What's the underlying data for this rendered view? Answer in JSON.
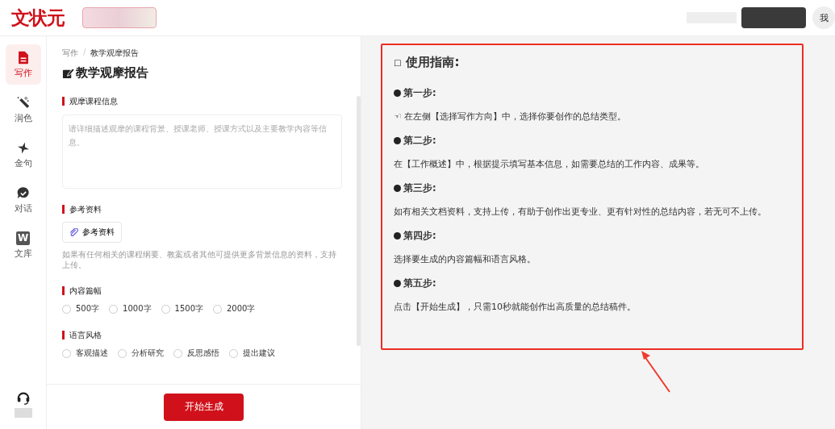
{
  "header": {
    "logo": "文状元",
    "avatar": "我"
  },
  "sidebar": {
    "items": [
      {
        "label": "写作",
        "kind": "doc",
        "selected": true
      },
      {
        "label": "润色",
        "kind": "wand",
        "selected": false
      },
      {
        "label": "金句",
        "kind": "star",
        "selected": false
      },
      {
        "label": "对话",
        "kind": "chat",
        "selected": false
      },
      {
        "label": "文库",
        "kind": "library",
        "selected": false,
        "glyph": "W"
      }
    ]
  },
  "form": {
    "breadcrumb": {
      "items": [
        "写作",
        "教学观摩报告"
      ],
      "separator": "/"
    },
    "title": "教学观摩报告",
    "sections": [
      {
        "kind": "textarea",
        "label": "观摩课程信息",
        "placeholder": "请详细描述观摩的课程背景、授课老师、授课方式以及主要教学内容等信息。"
      },
      {
        "kind": "upload",
        "label": "参考资料",
        "button": "参考资料",
        "hint": "如果有任何相关的课程纲要、教案或者其他可提供更多背景信息的资料，支持上传。"
      },
      {
        "kind": "radio",
        "label": "内容篇幅",
        "options": [
          {
            "label": "500字",
            "selected": false
          },
          {
            "label": "1000字",
            "selected": false
          },
          {
            "label": "1500字",
            "selected": false
          },
          {
            "label": "2000字",
            "selected": false
          }
        ]
      },
      {
        "kind": "radio",
        "label": "语言风格",
        "options": [
          {
            "label": "客观描述",
            "selected": false
          },
          {
            "label": "分析研究",
            "selected": false
          },
          {
            "label": "反思感悟",
            "selected": false
          },
          {
            "label": "提出建议",
            "selected": false
          }
        ]
      }
    ],
    "submit": "开始生成"
  },
  "guide": {
    "icon": "□",
    "title": "使用指南:",
    "steps": [
      {
        "heading": "第一步:",
        "marker": "☜",
        "text": "在左侧【选择写作方向】中，选择你要创作的总结类型。"
      },
      {
        "heading": "第二步:",
        "text": "在【工作概述】中，根据提示填写基本信息，如需要总结的工作内容、成果等。"
      },
      {
        "heading": "第三步:",
        "text": "如有相关文档资料，支持上传，有助于创作出更专业、更有针对性的总结内容，若无可不上传。"
      },
      {
        "heading": "第四步:",
        "text": "选择要生成的内容篇幅和语言风格。"
      },
      {
        "heading": "第五步:",
        "text": "点击【开始生成】，只需10秒就能创作出高质量的总结稿件。"
      }
    ]
  }
}
